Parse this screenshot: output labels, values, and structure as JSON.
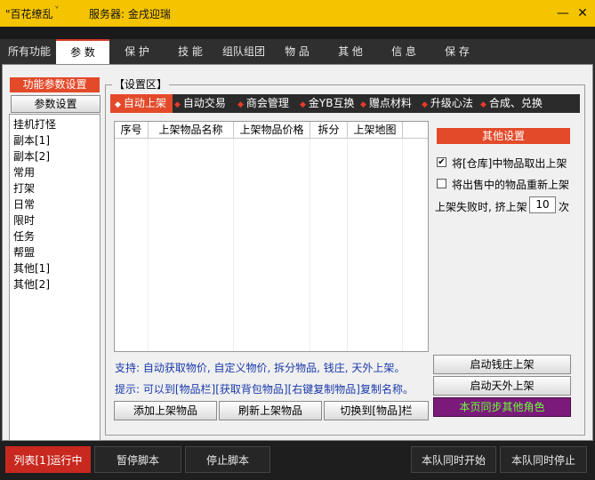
{
  "window": {
    "title": "\"百花缭乱",
    "server_label": "服务器: 金戌迎瑞",
    "controls": [
      "—",
      "✕"
    ]
  },
  "menu": [
    "所有功能",
    "参 数",
    "保 护",
    "技 能",
    "组队组团",
    "物 品",
    "其 他",
    "信 息",
    "保 存"
  ],
  "left": {
    "header": "功能参数设置",
    "settings_button": "参数设置",
    "items": [
      "挂机打怪",
      "副本[1]",
      "副本[2]",
      "常用",
      "打架",
      "日常",
      "限时",
      "任务",
      "帮盟",
      "其他[1]",
      "其他[2]"
    ]
  },
  "settings": {
    "title": "【设置区】",
    "tabs": [
      "自动上架",
      "自动交易",
      "商会管理",
      "金YB互换",
      "赠点材料",
      "升级心法",
      "合成、兑换"
    ],
    "table_headers": [
      "序号",
      "上架物品名称",
      "上架物品价格",
      "拆分",
      "上架地图"
    ],
    "note1": "支持: 自动获取物价, 自定义物价, 拆分物品, 钱庄, 天外上架。",
    "note2": "提示: 可以到[物品栏][获取背包物品][右键复制物品]复制名称。",
    "buttons": [
      "添加上架物品",
      "刷新上架物品",
      "切换到[物品]栏"
    ]
  },
  "other": {
    "header": "其他设置",
    "check1": "将[仓库]中物品取出上架",
    "check1_checked": true,
    "check2": "将出售中的物品重新上架",
    "check2_checked": false,
    "fail_label": "上架失败时, 挤上架",
    "fail_value": "10",
    "fail_unit": "次",
    "btn_bank": "启动钱庄上架",
    "btn_sky": "启动天外上架",
    "btn_sync": "本页同步其他角色",
    "sync_color": "#7a1a7a"
  },
  "bottom": {
    "running": "列表[1]运行中",
    "pause": "暂停脚本",
    "stop": "停止脚本",
    "team_start": "本队同时开始",
    "team_stop": "本队同时停止"
  },
  "colors": {
    "accent": "#e34a2a",
    "title_bar": "#f5c400"
  }
}
